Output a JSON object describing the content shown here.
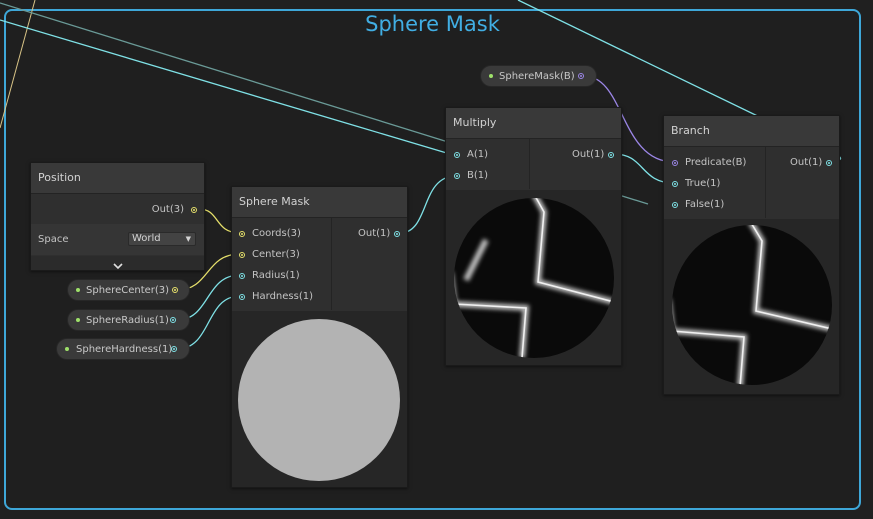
{
  "group": {
    "title": "Sphere Mask"
  },
  "nodes": {
    "position": {
      "title": "Position",
      "out_label": "Out(3)",
      "space_label": "Space",
      "space_value": "World",
      "expand_icon": "chevron-down-icon"
    },
    "sphere_mask": {
      "title": "Sphere Mask",
      "inputs": [
        "Coords(3)",
        "Center(3)",
        "Radius(1)",
        "Hardness(1)"
      ],
      "output": "Out(1)"
    },
    "multiply": {
      "title": "Multiply",
      "inputs": [
        "A(1)",
        "B(1)"
      ],
      "output": "Out(1)"
    },
    "branch": {
      "title": "Branch",
      "inputs": [
        "Predicate(B)",
        "True(1)",
        "False(1)"
      ],
      "output": "Out(1)"
    }
  },
  "properties": {
    "sphere_center": "SphereCenter(3)",
    "sphere_radius": "SphereRadius(1)",
    "sphere_hardness": "SphereHardness(1)",
    "sphere_mask_bool": "SphereMask(B)"
  },
  "colors": {
    "group_border": "#3ea7d8",
    "vector3_port": "#e6e06b",
    "float_port": "#7fe1e6",
    "boolean_port": "#9b86e6"
  }
}
